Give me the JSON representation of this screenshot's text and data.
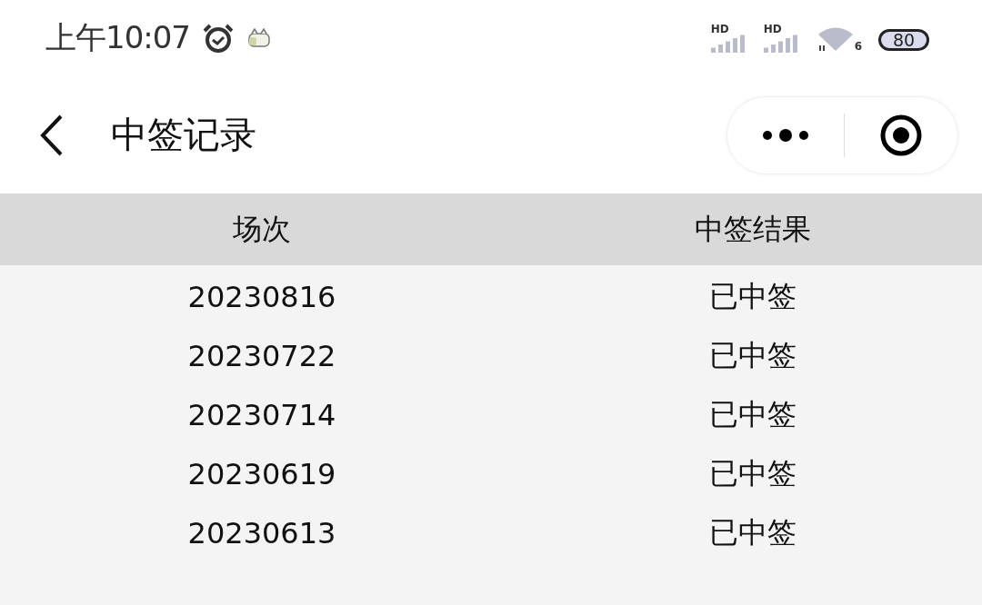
{
  "status_bar": {
    "time": "上午10:07",
    "signal_labels": [
      "HD",
      "HD"
    ],
    "wifi_label": "6",
    "battery": "80"
  },
  "nav": {
    "title": "中签记录"
  },
  "table": {
    "columns": [
      "场次",
      "中签结果"
    ],
    "rows": [
      [
        "20230816",
        "已中签"
      ],
      [
        "20230722",
        "已中签"
      ],
      [
        "20230714",
        "已中签"
      ],
      [
        "20230619",
        "已中签"
      ],
      [
        "20230613",
        "已中签"
      ]
    ]
  }
}
